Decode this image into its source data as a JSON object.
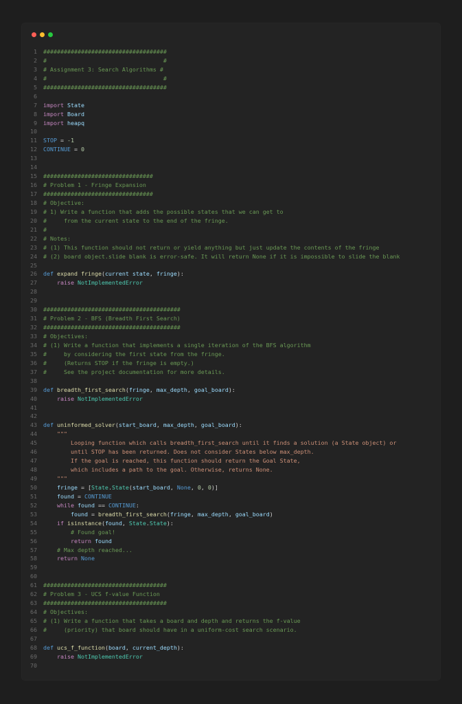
{
  "window": {
    "buttons": [
      {
        "name": "close",
        "color": "#ff5f56"
      },
      {
        "name": "minimize",
        "color": "#ffbd2e"
      },
      {
        "name": "maximize",
        "color": "#27c93f"
      }
    ]
  },
  "colors": {
    "background": "#1e1e1e",
    "panel": "#232323",
    "comment": "#6a9955",
    "keyword": "#c586c0",
    "def": "#569cd6",
    "variable": "#9cdcfe",
    "function": "#dcdcaa",
    "type": "#4ec9b0",
    "number": "#b5cea8",
    "string": "#ce9178",
    "line_number": "#6b6b6b"
  },
  "lines": [
    [
      [
        "c",
        "####################################"
      ]
    ],
    [
      [
        "c",
        "#                                  #"
      ]
    ],
    [
      [
        "c",
        "# Assignment 3: Search Algorithms #"
      ]
    ],
    [
      [
        "c",
        "#                                  #"
      ]
    ],
    [
      [
        "c",
        "####################################"
      ]
    ],
    [],
    [
      [
        "k",
        "import"
      ],
      [
        "p",
        " "
      ],
      [
        "n",
        "State"
      ]
    ],
    [
      [
        "k",
        "import"
      ],
      [
        "p",
        " "
      ],
      [
        "n",
        "Board"
      ]
    ],
    [
      [
        "k",
        "import"
      ],
      [
        "p",
        " "
      ],
      [
        "n",
        "heapq"
      ]
    ],
    [],
    [
      [
        "d",
        "STOP"
      ],
      [
        "p",
        " = "
      ],
      [
        "num",
        "-1"
      ]
    ],
    [
      [
        "d",
        "CONTINUE"
      ],
      [
        "p",
        " = "
      ],
      [
        "num",
        "0"
      ]
    ],
    [],
    [],
    [
      [
        "c",
        "################################"
      ]
    ],
    [
      [
        "c",
        "# Problem 1 - Fringe Expansion"
      ]
    ],
    [
      [
        "c",
        "################################"
      ]
    ],
    [
      [
        "c",
        "# Objective:"
      ]
    ],
    [
      [
        "c",
        "# 1) Write a function that adds the possible states that we can get to"
      ]
    ],
    [
      [
        "c",
        "#     from the current state to the end of the fringe."
      ]
    ],
    [
      [
        "c",
        "#"
      ]
    ],
    [
      [
        "c",
        "# Notes:"
      ]
    ],
    [
      [
        "c",
        "# (1) This function should not return or yield anything but just update the contents of the fringe"
      ]
    ],
    [
      [
        "c",
        "# (2) board object.slide blank is error-safe. It will return None if it is impossible to slide the blank"
      ]
    ],
    [],
    [
      [
        "d",
        "def"
      ],
      [
        "p",
        " "
      ],
      [
        "f",
        "expand fringe"
      ],
      [
        "p",
        "("
      ],
      [
        "n",
        "current state"
      ],
      [
        "p",
        ", "
      ],
      [
        "n",
        "fringe"
      ],
      [
        "p",
        "):"
      ]
    ],
    [
      [
        "p",
        "    "
      ],
      [
        "k",
        "raise"
      ],
      [
        "p",
        " "
      ],
      [
        "ty",
        "NotImplementedError"
      ]
    ],
    [],
    [],
    [
      [
        "c",
        "########################################"
      ]
    ],
    [
      [
        "c",
        "# Problem 2 - BFS (Breadth First Search)"
      ]
    ],
    [
      [
        "c",
        "########################################"
      ]
    ],
    [
      [
        "c",
        "# Objectives:"
      ]
    ],
    [
      [
        "c",
        "# (1) Write a function that implements a single iteration of the BFS algorithm"
      ]
    ],
    [
      [
        "c",
        "#     by considering the first state from the fringe."
      ]
    ],
    [
      [
        "c",
        "#     (Returns STOP if the fringe is empty.)"
      ]
    ],
    [
      [
        "c",
        "#     See the project documentation for more details."
      ]
    ],
    [],
    [
      [
        "d",
        "def"
      ],
      [
        "p",
        " "
      ],
      [
        "f",
        "breadth_first_search"
      ],
      [
        "p",
        "("
      ],
      [
        "n",
        "fringe"
      ],
      [
        "p",
        ", "
      ],
      [
        "n",
        "max_depth"
      ],
      [
        "p",
        ", "
      ],
      [
        "n",
        "goal_board"
      ],
      [
        "p",
        "):"
      ]
    ],
    [
      [
        "p",
        "    "
      ],
      [
        "k",
        "raise"
      ],
      [
        "p",
        " "
      ],
      [
        "ty",
        "NotImplementedError"
      ]
    ],
    [],
    [],
    [
      [
        "d",
        "def"
      ],
      [
        "p",
        " "
      ],
      [
        "f",
        "uninformed_solver"
      ],
      [
        "p",
        "("
      ],
      [
        "n",
        "start_board"
      ],
      [
        "p",
        ", "
      ],
      [
        "n",
        "max_depth"
      ],
      [
        "p",
        ", "
      ],
      [
        "n",
        "goal_board"
      ],
      [
        "p",
        "):"
      ]
    ],
    [
      [
        "s",
        "    \"\"\""
      ]
    ],
    [
      [
        "s",
        "        Looping function which calls breadth_first_search until it finds a solution (a State object) or"
      ]
    ],
    [
      [
        "s",
        "        until STOP has been returned. Does not consider States below max_depth."
      ]
    ],
    [
      [
        "s",
        "        If the goal is reached, this function should return the Goal State,"
      ]
    ],
    [
      [
        "s",
        "        which includes a path to the goal. Otherwise, returns None."
      ]
    ],
    [
      [
        "s",
        "    \"\"\""
      ]
    ],
    [
      [
        "p",
        "    "
      ],
      [
        "n",
        "fringe"
      ],
      [
        "p",
        " = ["
      ],
      [
        "ty",
        "State"
      ],
      [
        "p",
        "."
      ],
      [
        "ty",
        "State"
      ],
      [
        "p",
        "("
      ],
      [
        "n",
        "start_board"
      ],
      [
        "p",
        ", "
      ],
      [
        "d",
        "None"
      ],
      [
        "p",
        ", "
      ],
      [
        "num",
        "0"
      ],
      [
        "p",
        ", "
      ],
      [
        "num",
        "0"
      ],
      [
        "p",
        ")]"
      ]
    ],
    [
      [
        "p",
        "    "
      ],
      [
        "n",
        "found"
      ],
      [
        "p",
        " = "
      ],
      [
        "d",
        "CONTINUE"
      ]
    ],
    [
      [
        "p",
        "    "
      ],
      [
        "k",
        "while"
      ],
      [
        "p",
        " "
      ],
      [
        "n",
        "found"
      ],
      [
        "p",
        " == "
      ],
      [
        "d",
        "CONTINUE"
      ],
      [
        "p",
        ":"
      ]
    ],
    [
      [
        "p",
        "        "
      ],
      [
        "n",
        "found"
      ],
      [
        "p",
        " = "
      ],
      [
        "f",
        "breadth_first_search"
      ],
      [
        "p",
        "("
      ],
      [
        "n",
        "fringe"
      ],
      [
        "p",
        ", "
      ],
      [
        "n",
        "max_depth"
      ],
      [
        "p",
        ", "
      ],
      [
        "n",
        "goal_board"
      ],
      [
        "p",
        ")"
      ]
    ],
    [
      [
        "p",
        "    "
      ],
      [
        "k",
        "if"
      ],
      [
        "p",
        " "
      ],
      [
        "f",
        "isinstance"
      ],
      [
        "p",
        "("
      ],
      [
        "n",
        "found"
      ],
      [
        "p",
        ", "
      ],
      [
        "ty",
        "State"
      ],
      [
        "p",
        "."
      ],
      [
        "ty",
        "State"
      ],
      [
        "p",
        "):"
      ]
    ],
    [
      [
        "p",
        "        "
      ],
      [
        "c",
        "# Found goal!"
      ]
    ],
    [
      [
        "p",
        "        "
      ],
      [
        "k",
        "return"
      ],
      [
        "p",
        " "
      ],
      [
        "n",
        "found"
      ]
    ],
    [
      [
        "p",
        "    "
      ],
      [
        "c",
        "# Max depth reached..."
      ]
    ],
    [
      [
        "p",
        "    "
      ],
      [
        "k",
        "return"
      ],
      [
        "p",
        " "
      ],
      [
        "d",
        "None"
      ]
    ],
    [],
    [],
    [
      [
        "c",
        "####################################"
      ]
    ],
    [
      [
        "c",
        "# Problem 3 - UCS f-value Function"
      ]
    ],
    [
      [
        "c",
        "####################################"
      ]
    ],
    [
      [
        "c",
        "# Objectives:"
      ]
    ],
    [
      [
        "c",
        "# (1) Write a function that takes a board and depth and returns the f-value"
      ]
    ],
    [
      [
        "c",
        "#     (priority) that board should have in a uniform-cost search scenario."
      ]
    ],
    [],
    [
      [
        "d",
        "def"
      ],
      [
        "p",
        " "
      ],
      [
        "f",
        "ucs_f_function"
      ],
      [
        "p",
        "("
      ],
      [
        "n",
        "board"
      ],
      [
        "p",
        ", "
      ],
      [
        "n",
        "current_depth"
      ],
      [
        "p",
        "):"
      ]
    ],
    [
      [
        "p",
        "    "
      ],
      [
        "k",
        "raise"
      ],
      [
        "p",
        " "
      ],
      [
        "ty",
        "NotImplementedError"
      ]
    ],
    []
  ]
}
